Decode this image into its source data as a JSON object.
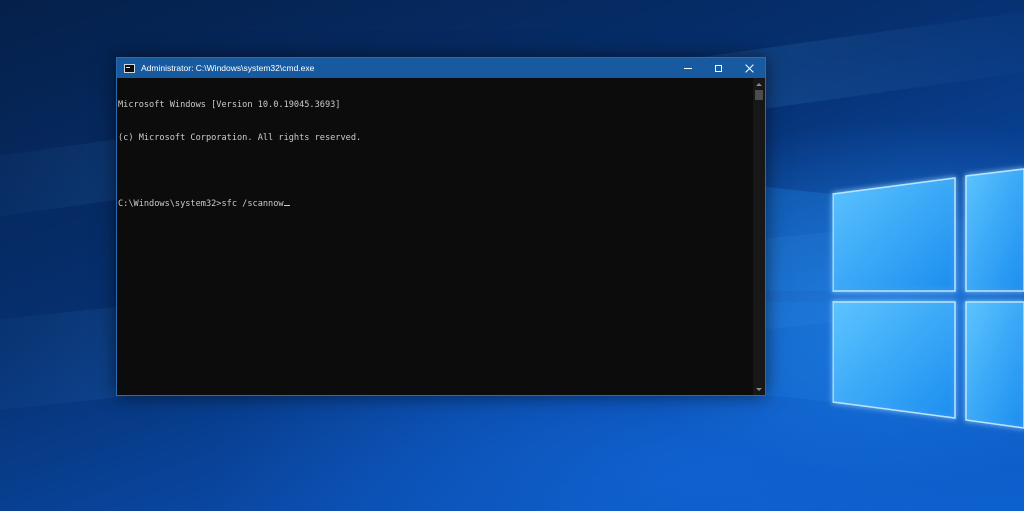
{
  "window": {
    "title": "Administrator: C:\\Windows\\system32\\cmd.exe",
    "icon": "cmd-icon"
  },
  "controls": {
    "minimize_icon": "minimize-icon",
    "maximize_icon": "maximize-icon",
    "close_icon": "close-icon"
  },
  "console": {
    "lines": [
      "Microsoft Windows [Version 10.0.19045.3693]",
      "(c) Microsoft Corporation. All rights reserved.",
      "",
      "C:\\Windows\\system32>sfc /scannow"
    ]
  },
  "colors": {
    "titlebar": "#185aa0",
    "console_background": "#0c0c0c",
    "console_text": "#cccccc",
    "desktop_accent": "#2f9bff"
  }
}
